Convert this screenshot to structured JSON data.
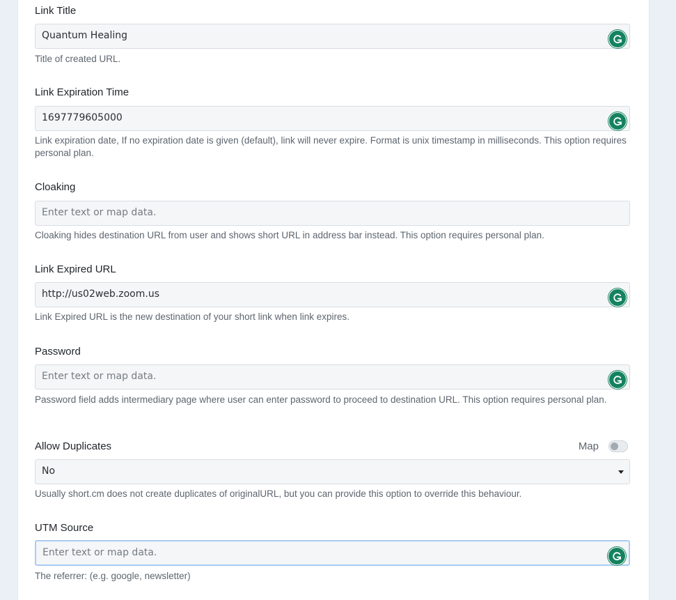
{
  "form": {
    "link_title": {
      "label": "Link Title",
      "value": "Quantum Healing",
      "help": "Title of created URL."
    },
    "link_expiration_time": {
      "label": "Link Expiration Time",
      "value": "1697779605000",
      "help": "Link expiration date, If no expiration date is given (default), link will never expire. Format is unix timestamp in milliseconds. This option requires personal plan."
    },
    "cloaking": {
      "label": "Cloaking",
      "placeholder": "Enter text or map data.",
      "help": "Cloaking hides destination URL from user and shows short URL in address bar instead. This option requires personal plan."
    },
    "link_expired_url": {
      "label": "Link Expired URL",
      "value": "http://us02web.zoom.us",
      "help": "Link Expired URL is the new destination of your short link when link expires."
    },
    "password": {
      "label": "Password",
      "placeholder": "Enter text or map data.",
      "help": "Password field adds intermediary page where user can enter password to proceed to destination URL. This option requires personal plan."
    },
    "allow_duplicates": {
      "label": "Allow Duplicates",
      "map_label": "Map",
      "map_toggle_on": false,
      "selected": "No",
      "help": "Usually short.cm does not create duplicates of originalURL, but you can provide this option to override this behaviour."
    },
    "utm_source": {
      "label": "UTM Source",
      "placeholder": "Enter text or map data.",
      "help": "The referrer: (e.g. google, newsletter)"
    }
  },
  "icons": {
    "grammarly": "grammarly-icon",
    "grammarly_color": "#15825f",
    "dropdown": "caret-down-icon"
  },
  "colors": {
    "background": "#ebf0f7",
    "focus_border": "#a9cdf3"
  }
}
